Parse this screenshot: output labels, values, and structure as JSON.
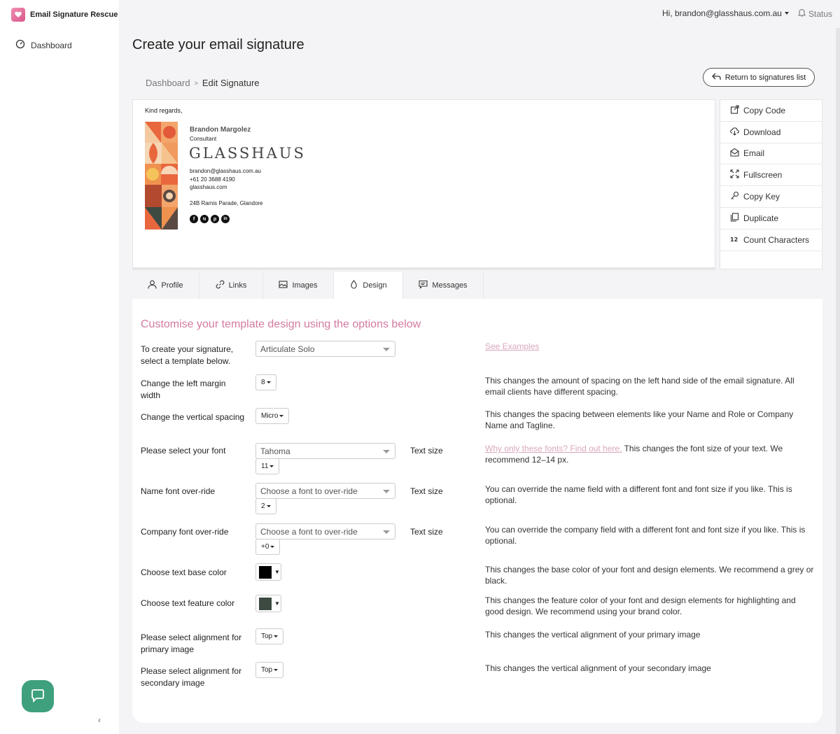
{
  "app": {
    "name": "Email Signature Rescue"
  },
  "sidebar": {
    "items": [
      {
        "label": "Dashboard"
      }
    ],
    "collapse_glyph": "‹"
  },
  "topbar": {
    "user": "Hi, brandon@glasshaus.com.au",
    "status": "Status"
  },
  "page": {
    "title": "Create your email signature"
  },
  "breadcrumb": {
    "root": "Dashboard",
    "separator": ">",
    "current": "Edit Signature"
  },
  "return_button": {
    "label": "Return to signatures list"
  },
  "signature": {
    "greeting": "Kind regards,",
    "name": "Brandon Margolez",
    "role": "Consultant",
    "company_logo": "GLASSHAUS",
    "email": "brandon@glasshaus.com.au",
    "phone": "+61 20 3688 4190",
    "website": "glasshaus.com",
    "address": "24B Ramis Parade, Glandore",
    "social": [
      "f",
      "ig",
      "p",
      "in"
    ]
  },
  "actions": [
    {
      "label": "Copy Code",
      "icon": "copy-code-icon"
    },
    {
      "label": "Download",
      "icon": "download-icon"
    },
    {
      "label": "Email",
      "icon": "email-icon"
    },
    {
      "label": "Fullscreen",
      "icon": "fullscreen-icon"
    },
    {
      "label": "Copy Key",
      "icon": "key-icon"
    },
    {
      "label": "Duplicate",
      "icon": "duplicate-icon"
    },
    {
      "label": "Count Characters",
      "icon": "count-icon"
    }
  ],
  "tabs": [
    {
      "label": "Profile",
      "icon": "user-icon"
    },
    {
      "label": "Links",
      "icon": "link-icon"
    },
    {
      "label": "Images",
      "icon": "image-icon"
    },
    {
      "label": "Design",
      "icon": "drop-icon",
      "active": true
    },
    {
      "label": "Messages",
      "icon": "message-icon"
    }
  ],
  "design": {
    "heading": "Customise your template design using the options below",
    "see_examples": "See Examples",
    "text_size_label": "Text size",
    "template": {
      "label": "To create your signature, select a template below.",
      "value": "Articulate Solo"
    },
    "left_margin": {
      "label": "Change the left margin width",
      "value": "8",
      "desc": "This changes the amount of spacing on the left hand side of the email signature. All email clients have different spacing."
    },
    "vertical_spacing": {
      "label": "Change the vertical spacing",
      "value": "Micro",
      "desc": "This changes the spacing between elements like your Name and Role or Company Name and Tagline."
    },
    "font": {
      "label": "Please select your font",
      "value": "Tahoma",
      "size": "11",
      "desc_link": "Why only these fonts? Find out here.",
      "desc": " This changes the font size of your text. We recommend 12–14 px."
    },
    "name_font": {
      "label": "Name font over-ride",
      "value": "Choose a font to over-ride",
      "size": "2",
      "desc": "You can override the name field with a different font and font size if you like. This is optional."
    },
    "company_font": {
      "label": "Company font over-ride",
      "value": "Choose a font to over-ride",
      "size": "+0",
      "desc": "You can override the company field with a different font and font size if you like. This is optional."
    },
    "base_color": {
      "label": "Choose text base color",
      "color": "#000000",
      "desc": "This changes the base color of your font and design elements. We recommend a grey or black."
    },
    "feature_color": {
      "label": "Choose text feature color",
      "color": "#3d4a42",
      "desc": "This changes the feature color of your font and design elements for highlighting and good design. We recommend using your brand color."
    },
    "primary_align": {
      "label": "Please select alignment for primary image",
      "value": "Top",
      "desc": "This changes the vertical alignment of your primary image"
    },
    "secondary_align": {
      "label": "Please select alignment for secondary image",
      "value": "Top",
      "desc": "This changes the vertical alignment of your secondary image"
    }
  }
}
